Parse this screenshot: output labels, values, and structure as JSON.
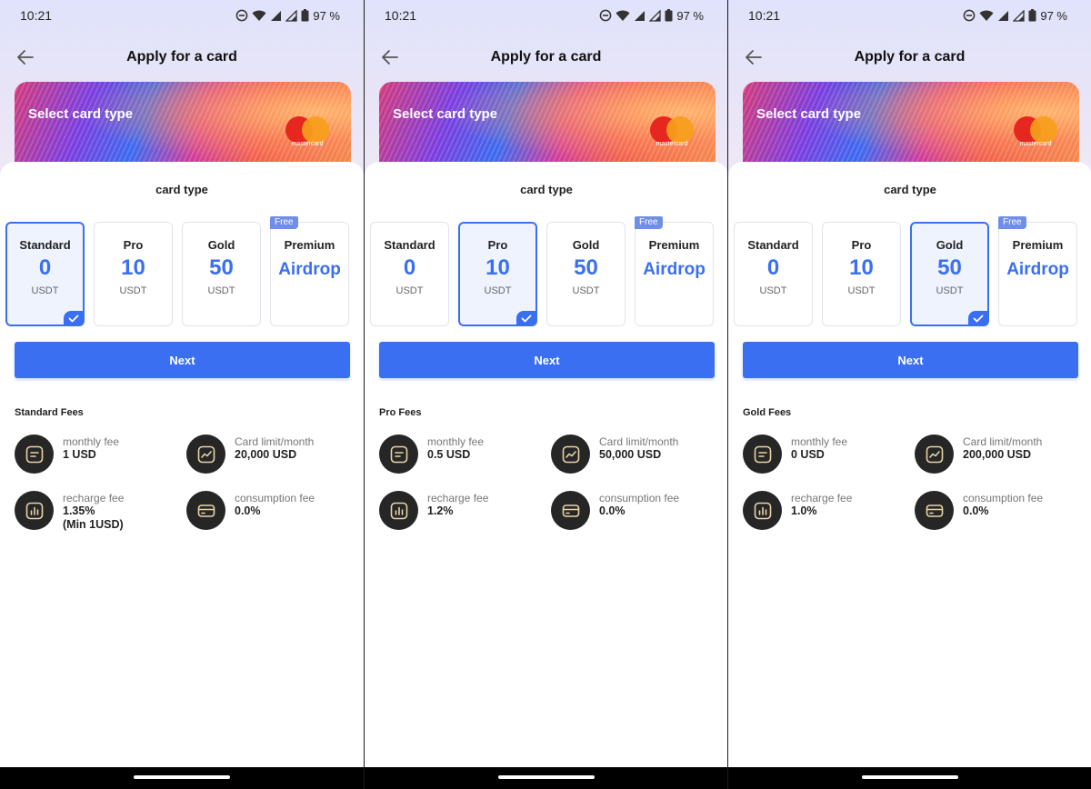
{
  "screens": [
    {
      "status": {
        "time": "10:21",
        "battery": "97 %"
      },
      "title": "Apply for a card",
      "banner_title": "Select card type",
      "brand": "mastercard",
      "section_title": "card type",
      "card_types": [
        {
          "name": "Standard",
          "price": "0",
          "unit": "USDT"
        },
        {
          "name": "Pro",
          "price": "10",
          "unit": "USDT"
        },
        {
          "name": "Gold",
          "price": "50",
          "unit": "USDT"
        },
        {
          "name": "Premium",
          "price": "Airdrop",
          "unit": "",
          "tag": "Free"
        }
      ],
      "selected_index": 0,
      "next_label": "Next",
      "fees_title": "Standard Fees",
      "fees": {
        "monthly": {
          "label": "monthly fee",
          "value": "1 USD"
        },
        "limit": {
          "label": "Card limit/month",
          "value": "20,000 USD"
        },
        "recharge": {
          "label": "recharge fee",
          "value": "1.35%\n(Min 1USD)"
        },
        "consumption": {
          "label": "consumption fee",
          "value": "0.0%"
        }
      }
    },
    {
      "status": {
        "time": "10:21",
        "battery": "97 %"
      },
      "title": "Apply for a card",
      "banner_title": "Select card type",
      "brand": "mastercard",
      "section_title": "card type",
      "card_types": [
        {
          "name": "Standard",
          "price": "0",
          "unit": "USDT"
        },
        {
          "name": "Pro",
          "price": "10",
          "unit": "USDT"
        },
        {
          "name": "Gold",
          "price": "50",
          "unit": "USDT"
        },
        {
          "name": "Premium",
          "price": "Airdrop",
          "unit": "",
          "tag": "Free"
        }
      ],
      "selected_index": 1,
      "next_label": "Next",
      "fees_title": "Pro Fees",
      "fees": {
        "monthly": {
          "label": "monthly fee",
          "value": "0.5 USD"
        },
        "limit": {
          "label": "Card limit/month",
          "value": "50,000 USD"
        },
        "recharge": {
          "label": "recharge fee",
          "value": "1.2%"
        },
        "consumption": {
          "label": "consumption fee",
          "value": "0.0%"
        }
      }
    },
    {
      "status": {
        "time": "10:21",
        "battery": "97 %"
      },
      "title": "Apply for a card",
      "banner_title": "Select card type",
      "brand": "mastercard",
      "section_title": "card type",
      "card_types": [
        {
          "name": "Standard",
          "price": "0",
          "unit": "USDT"
        },
        {
          "name": "Pro",
          "price": "10",
          "unit": "USDT"
        },
        {
          "name": "Gold",
          "price": "50",
          "unit": "USDT"
        },
        {
          "name": "Premium",
          "price": "Airdrop",
          "unit": "",
          "tag": "Free"
        }
      ],
      "selected_index": 2,
      "next_label": "Next",
      "fees_title": "Gold Fees",
      "fees": {
        "monthly": {
          "label": "monthly fee",
          "value": "0 USD"
        },
        "limit": {
          "label": "Card limit/month",
          "value": "200,000 USD"
        },
        "recharge": {
          "label": "recharge fee",
          "value": "1.0%"
        },
        "consumption": {
          "label": "consumption fee",
          "value": "0.0%"
        }
      }
    }
  ],
  "icons": {
    "back": "arrow-left-icon",
    "dnd": "do-not-disturb-icon",
    "wifi": "wifi-icon",
    "signal": "signal-icon",
    "battery": "battery-icon",
    "check": "checkmark-icon",
    "monthly": "document-icon",
    "limit": "trend-chart-icon",
    "recharge": "bar-chart-icon",
    "consumption": "credit-card-icon"
  },
  "colors": {
    "accent": "#3a6ff2",
    "selected_bg": "#eef3fe",
    "fee_icon_bg": "#262626",
    "fee_icon_stroke": "#e8d5a8",
    "free_tag": "#6e8ee8"
  }
}
